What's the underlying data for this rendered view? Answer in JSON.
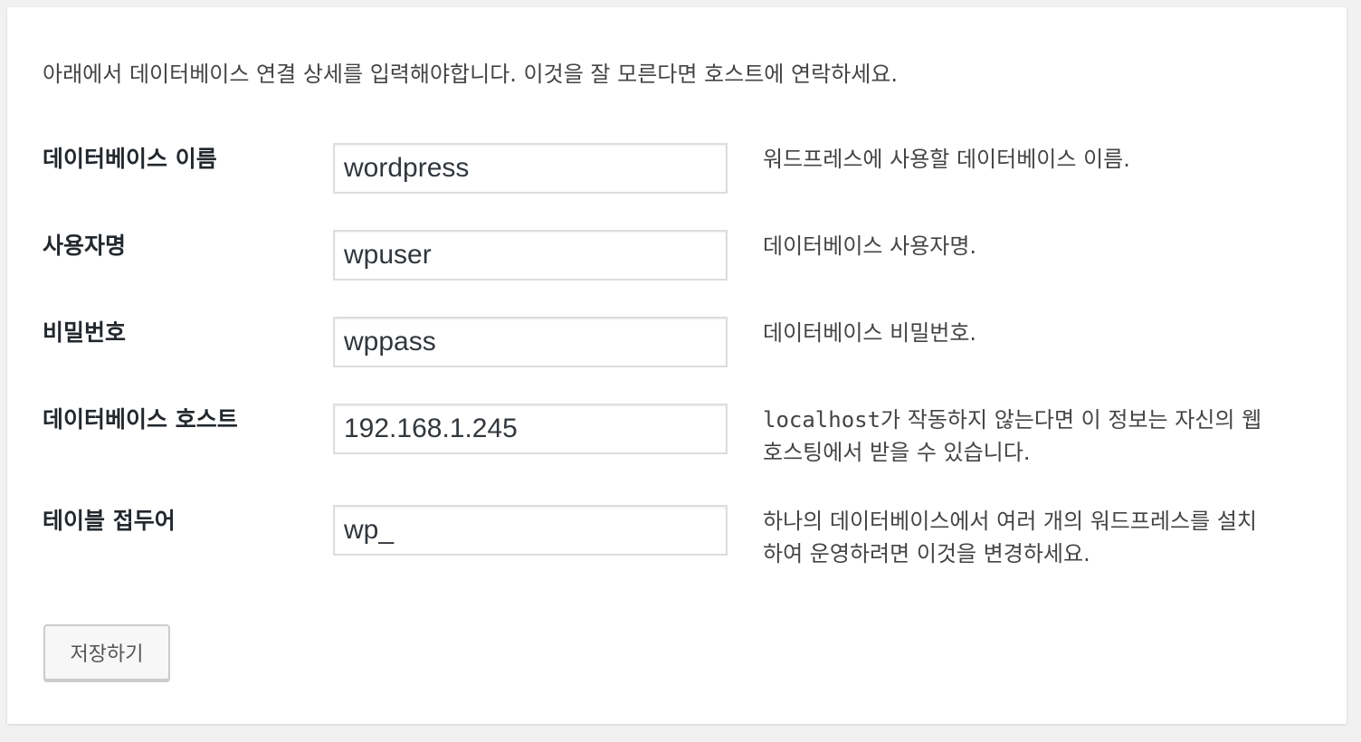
{
  "intro_text": "아래에서 데이터베이스 연결 상세를 입력해야합니다. 이것을 잘 모른다면 호스트에 연락하세요.",
  "fields": [
    {
      "label": "데이터베이스 이름",
      "value": "wordpress",
      "help": "워드프레스에 사용할 데이터베이스 이름."
    },
    {
      "label": "사용자명",
      "value": "wpuser",
      "help": "데이터베이스 사용자명."
    },
    {
      "label": "비밀번호",
      "value": "wppass",
      "help": "데이터베이스 비밀번호."
    },
    {
      "label": "데이터베이스 호스트",
      "value": "192.168.1.245",
      "help_code": "localhost",
      "help": "가 작동하지 않는다면 이 정보는 자신의 웹호스팅에서 받을 수 있습니다."
    },
    {
      "label": "테이블 접두어",
      "value": "wp_",
      "help": "하나의 데이터베이스에서 여러 개의 워드프레스를 설치하여 운영하려면 이것을 변경하세요."
    }
  ],
  "save_button_label": "저장하기"
}
